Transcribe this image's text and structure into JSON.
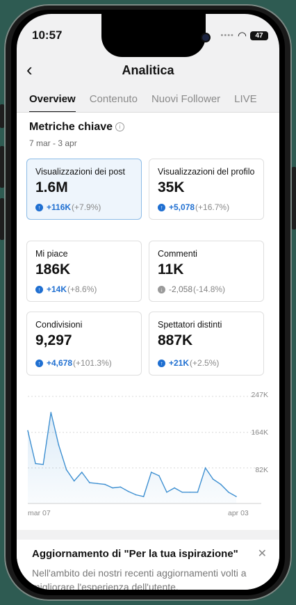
{
  "status": {
    "time": "10:57",
    "battery": "47"
  },
  "header": {
    "title": "Analitica"
  },
  "tabs": [
    {
      "label": "Overview"
    },
    {
      "label": "Contenuto"
    },
    {
      "label": "Nuovi Follower"
    },
    {
      "label": "LIVE"
    }
  ],
  "section": {
    "title": "Metriche chiave",
    "date_range": "7 mar - 3 apr"
  },
  "metrics": [
    {
      "label": "Visualizzazioni dei post",
      "value": "1.6M",
      "change": "+116K",
      "pct": "(+7.9%)",
      "trend": "up"
    },
    {
      "label": "Visualizzazioni del profilo",
      "value": "35K",
      "change": "+5,078",
      "pct": "(+16.7%)",
      "trend": "up"
    },
    {
      "label": "Mi piace",
      "value": "186K",
      "change": "+14K",
      "pct": "(+8.6%)",
      "trend": "up"
    },
    {
      "label": "Commenti",
      "value": "11K",
      "change": "-2,058",
      "pct": "(-14.8%)",
      "trend": "down"
    },
    {
      "label": "Condivisioni",
      "value": "9,297",
      "change": "+4,678",
      "pct": "(+101.3%)",
      "trend": "up"
    },
    {
      "label": "Spettatori distinti",
      "value": "887K",
      "change": "+21K",
      "pct": "(+2.5%)",
      "trend": "up"
    }
  ],
  "chart_data": {
    "type": "area",
    "x_tick_labels": [
      "mar 07",
      "apr 03"
    ],
    "y_tick_labels": [
      "82K",
      "164K",
      "247K"
    ],
    "ylim": [
      0,
      247
    ],
    "series": [
      {
        "values": [
          168,
          92,
          90,
          210,
          135,
          78,
          52,
          72,
          48,
          46,
          44,
          36,
          38,
          28,
          20,
          16,
          72,
          64,
          26,
          36,
          26,
          26,
          26,
          82,
          56,
          44,
          26,
          16
        ]
      }
    ]
  },
  "notice": {
    "title": "Aggiornamento di \"Per la tua ispirazione\"",
    "body": "Nell'ambito dei nostri recenti aggiornamenti volti a migliorare l'esperienza dell'utente,"
  },
  "colors": {
    "accent": "#1f6fd1",
    "selected_bg": "#eef5fc",
    "line": "#3d8fd1"
  },
  "icons": {
    "back": "chevron-left-icon",
    "info": "info-icon",
    "close": "close-icon",
    "up": "arrow-up-circle-icon",
    "down": "arrow-down-circle-icon"
  }
}
